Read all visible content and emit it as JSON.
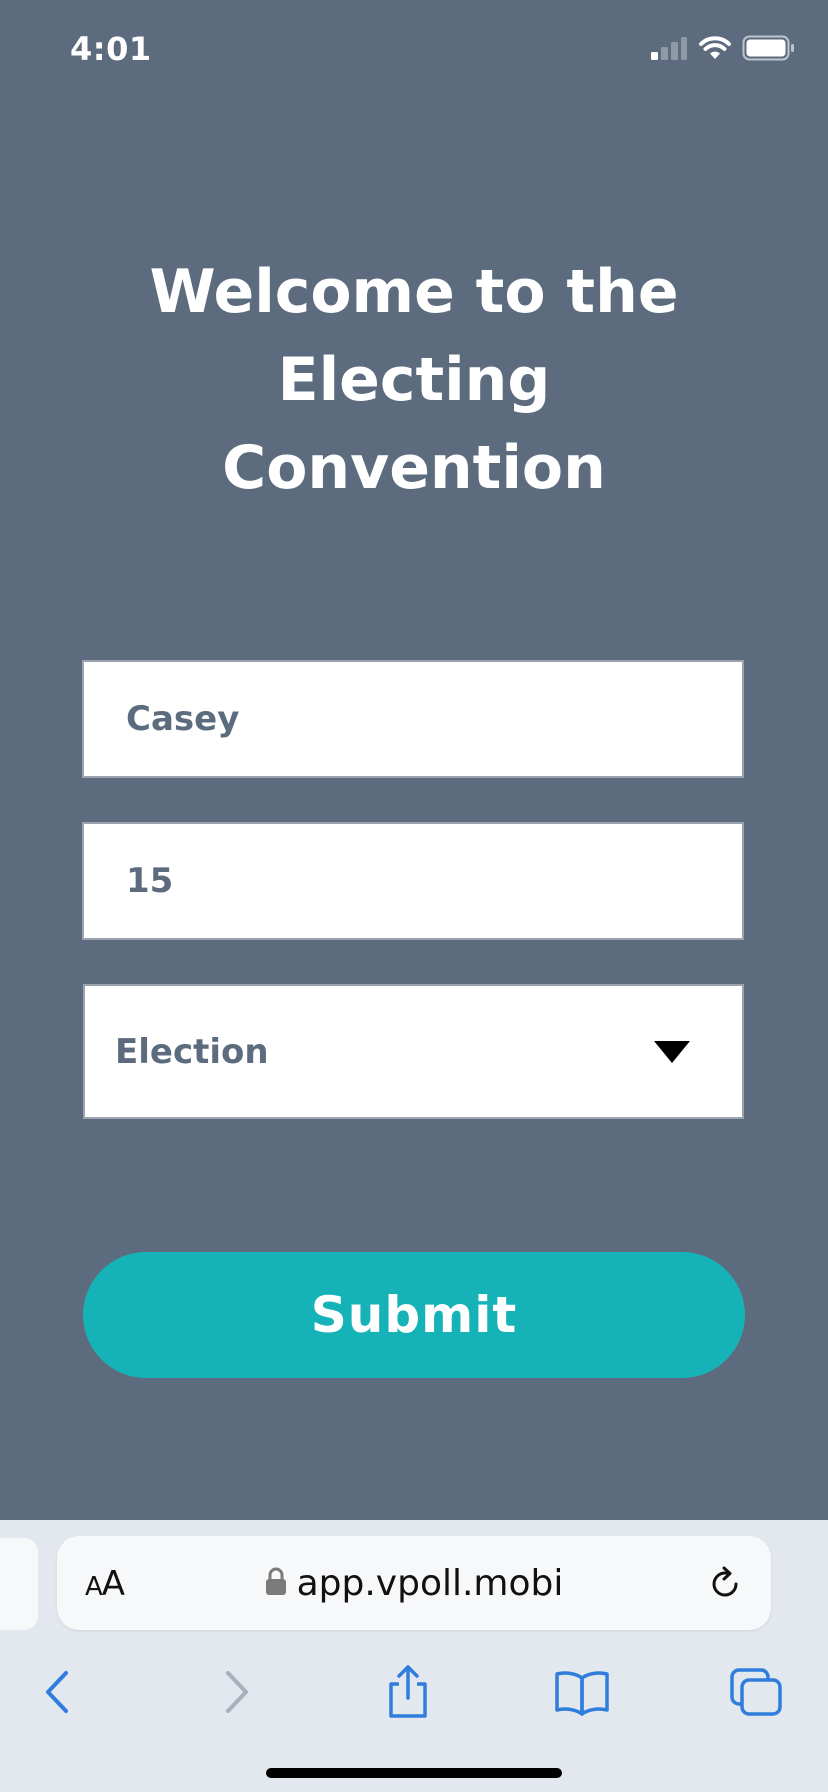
{
  "status_bar": {
    "time": "4:01"
  },
  "form": {
    "title": "Welcome to the\nElecting\nConvention",
    "name_value": "Casey",
    "number_value": "15",
    "select_value": "Election",
    "submit_label": "Submit"
  },
  "browser": {
    "aa_small": "A",
    "aa_large": "A",
    "url": "app.vpoll.mobi"
  },
  "colors": {
    "background": "#5d6b7e",
    "accent": "#15b3b7",
    "browser_tint": "#2f7ddc"
  },
  "icons": {
    "status": [
      "cellular-signal-icon",
      "wifi-icon",
      "battery-icon"
    ],
    "toolbar": [
      "back-icon",
      "forward-icon",
      "share-icon",
      "bookmarks-icon",
      "tabs-icon"
    ]
  }
}
